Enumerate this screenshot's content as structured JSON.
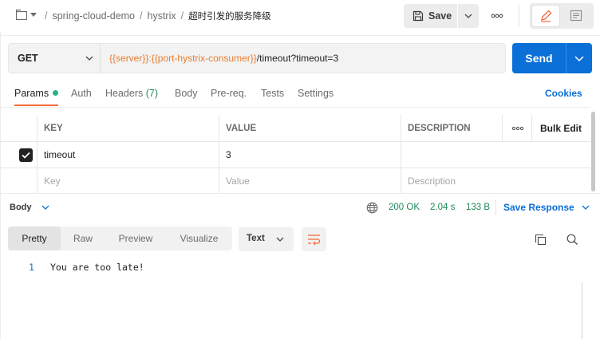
{
  "breadcrumb": {
    "items": [
      "spring-cloud-demo",
      "hystrix"
    ],
    "current": "超时引发的服务降级",
    "separator": "/"
  },
  "toolbar": {
    "save_label": "Save"
  },
  "request": {
    "method": "GET",
    "url_parts": [
      {
        "text": "{{server}}",
        "var": true
      },
      {
        "text": ":",
        "var": false
      },
      {
        "text": "{{port-hystrix-consumer}}",
        "var": true
      },
      {
        "text": "/timeout?timeout=3",
        "var": false
      }
    ],
    "send_label": "Send"
  },
  "tabs": {
    "params": "Params",
    "auth": "Auth",
    "headers": "Headers",
    "headers_count": "(7)",
    "body": "Body",
    "prereq": "Pre-req.",
    "tests": "Tests",
    "settings": "Settings",
    "cookies": "Cookies"
  },
  "params_table": {
    "headers": {
      "key": "KEY",
      "value": "VALUE",
      "description": "DESCRIPTION",
      "bulk_edit": "Bulk Edit"
    },
    "rows": [
      {
        "checked": true,
        "key": "timeout",
        "value": "3",
        "description": ""
      }
    ],
    "placeholders": {
      "key": "Key",
      "value": "Value",
      "description": "Description"
    }
  },
  "response": {
    "body_label": "Body",
    "status": "200 OK",
    "time": "2.04 s",
    "size": "133 B",
    "save_response": "Save Response",
    "view_tabs": [
      "Pretty",
      "Raw",
      "Preview",
      "Visualize"
    ],
    "active_view": "Pretty",
    "format": "Text",
    "lines": [
      {
        "num": "1",
        "text": "You are too late!"
      }
    ]
  },
  "colors": {
    "accent": "#0a6fd7",
    "variable": "#e97c2e",
    "status_ok": "#1f8a57",
    "tab_active": "#f26b3a",
    "params_dot": "#26b47f"
  },
  "icons": {
    "collection": "collection-icon",
    "save": "save-icon",
    "more": "more-horizontal-icon",
    "edit": "pencil-icon",
    "docs": "document-icon",
    "globe": "globe-icon",
    "wrap": "wrap-lines-icon",
    "copy": "copy-icon",
    "search": "search-icon"
  }
}
